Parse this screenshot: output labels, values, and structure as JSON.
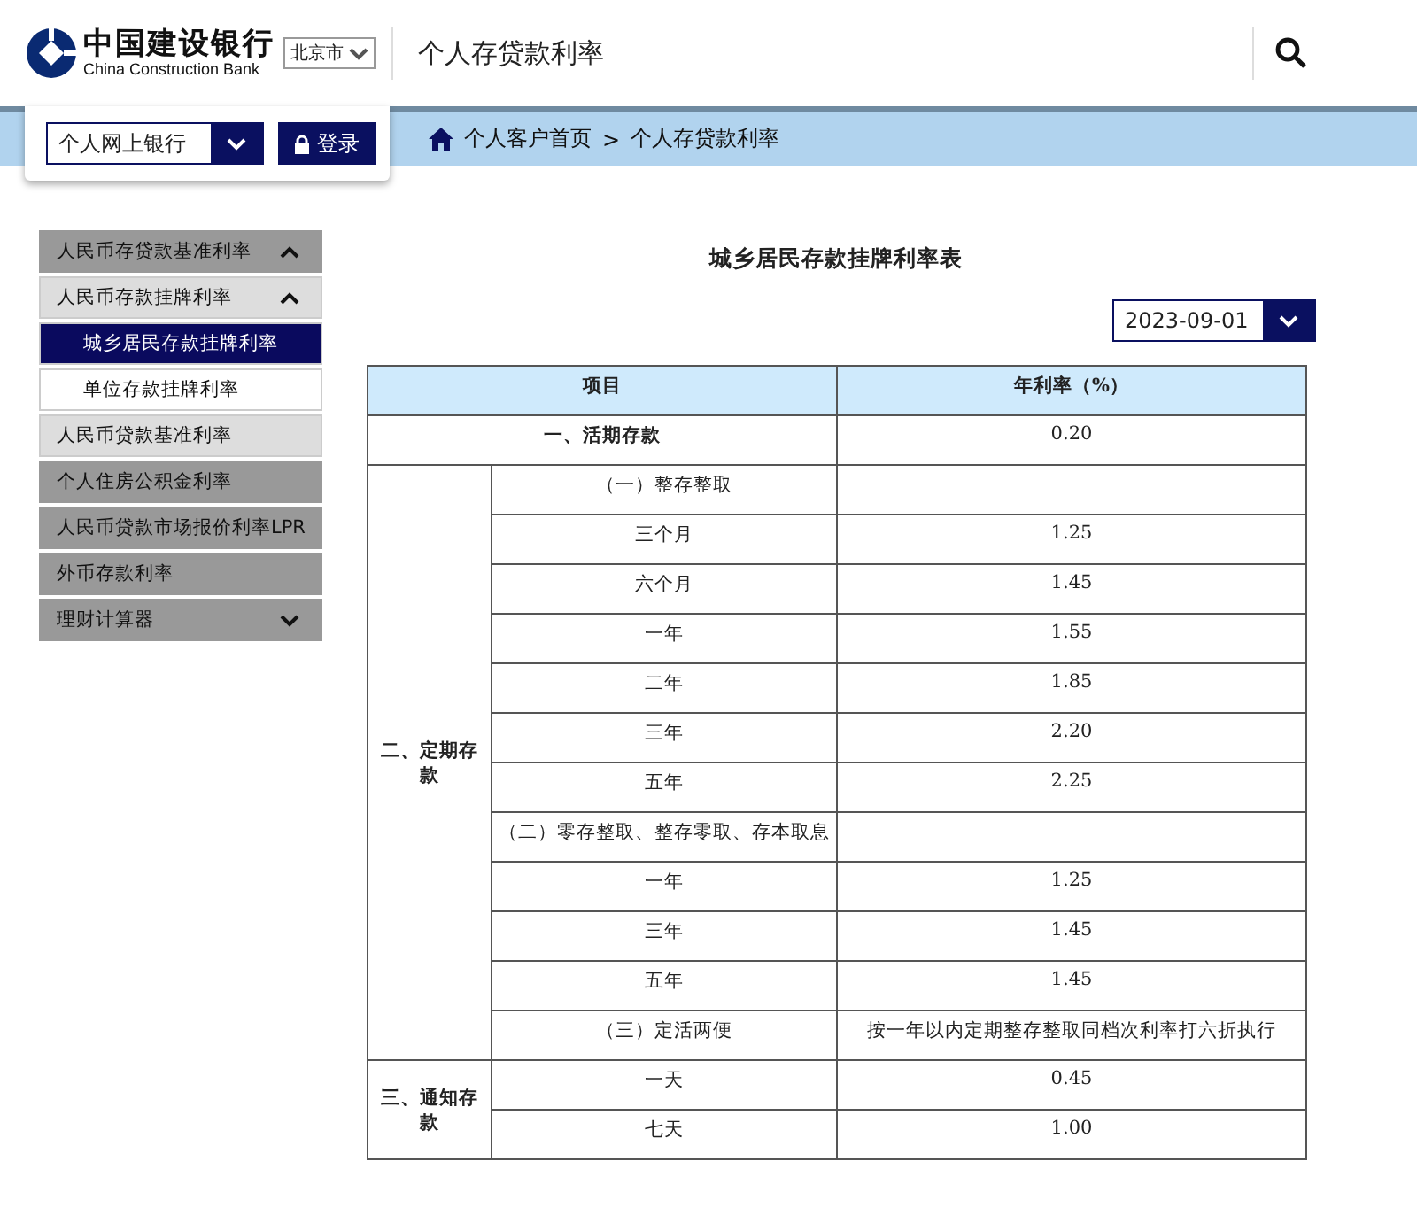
{
  "header": {
    "logo_cn": "中国建设银行",
    "logo_en": "China Construction Bank",
    "city": "北京市",
    "title": "个人存贷款利率"
  },
  "login": {
    "bank_select": "个人网上银行",
    "button": "登录"
  },
  "breadcrumb": [
    "个人客户首页",
    ">",
    "个人存贷款利率"
  ],
  "sidebar": {
    "items": [
      {
        "label": "人民币存贷款基准利率",
        "expanded": true,
        "children": [
          {
            "label": "人民币存款挂牌利率",
            "expanded": true,
            "children": [
              {
                "label": "城乡居民存款挂牌利率",
                "selected": true
              },
              {
                "label": "单位存款挂牌利率",
                "selected": false
              }
            ]
          },
          {
            "label": "人民币贷款基准利率"
          }
        ]
      },
      {
        "label": "个人住房公积金利率"
      },
      {
        "label": "人民币贷款市场报价利率LPR"
      },
      {
        "label": "外币存款利率"
      },
      {
        "label": "理财计算器",
        "expanded": false
      }
    ]
  },
  "main": {
    "title": "城乡居民存款挂牌利率表",
    "date": "2023-09-01"
  },
  "table": {
    "columns": [
      "项目",
      "年利率（%）"
    ],
    "sections": [
      {
        "kind": "single",
        "label": "一、活期存款",
        "rate": "0.20"
      },
      {
        "kind": "group",
        "label": "二、定期存款",
        "rows": [
          {
            "item": "（一）整存整取"
          },
          {
            "item": "三个月",
            "rate": "1.25"
          },
          {
            "item": "六个月",
            "rate": "1.45"
          },
          {
            "item": "一年",
            "rate": "1.55"
          },
          {
            "item": "二年",
            "rate": "1.85"
          },
          {
            "item": "三年",
            "rate": "2.20"
          },
          {
            "item": "五年",
            "rate": "2.25"
          },
          {
            "item": "（二）零存整取、整存零取、存本取息"
          },
          {
            "item": "一年",
            "rate": "1.25"
          },
          {
            "item": "三年",
            "rate": "1.45"
          },
          {
            "item": "五年",
            "rate": "1.45"
          },
          {
            "item": "（三）定活两便",
            "rate": "按一年以内定期整存整取同档次利率打六折执行"
          }
        ]
      },
      {
        "kind": "group",
        "label": "三、通知存款",
        "rows": [
          {
            "item": "一天",
            "rate": "0.45"
          },
          {
            "item": "七天",
            "rate": "1.00"
          }
        ]
      }
    ]
  }
}
